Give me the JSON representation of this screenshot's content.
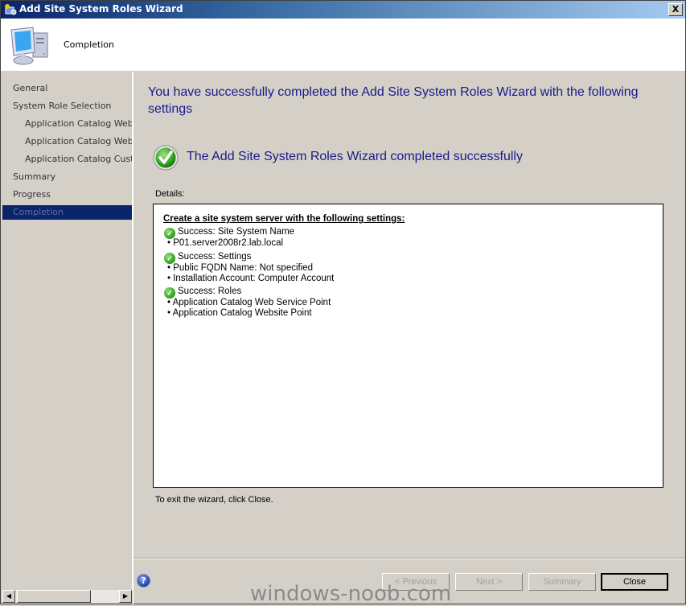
{
  "window": {
    "title": "Add Site System Roles Wizard",
    "close_label": "X"
  },
  "header": {
    "title": "Completion",
    "icon": "computer-icon"
  },
  "nav": {
    "items": [
      {
        "label": "General",
        "level": "top",
        "active": false
      },
      {
        "label": "System Role Selection",
        "level": "top",
        "active": false
      },
      {
        "label": "Application Catalog Web Service Point",
        "level": "sub",
        "active": false
      },
      {
        "label": "Application Catalog Website Point",
        "level": "sub",
        "active": false
      },
      {
        "label": "Application Catalog Customizations",
        "level": "sub",
        "active": false
      },
      {
        "label": "Summary",
        "level": "top",
        "active": false
      },
      {
        "label": "Progress",
        "level": "top",
        "active": false
      },
      {
        "label": "Completion",
        "level": "top",
        "active": true
      }
    ]
  },
  "main": {
    "heading": "You have successfully completed the Add Site System Roles Wizard with the following settings",
    "success_message": "The Add Site System Roles Wizard completed successfully",
    "details_label": "Details:",
    "details": {
      "header": "Create a site system server with the following settings:",
      "sections": [
        {
          "status": "Success: Site System Name",
          "items": [
            "P01.server2008r2.lab.local"
          ]
        },
        {
          "status": "Success: Settings",
          "items": [
            "Public FQDN Name: Not specified",
            "Installation Account: Computer Account"
          ]
        },
        {
          "status": "Success: Roles",
          "items": [
            "Application Catalog Web Service Point",
            "Application Catalog Website Point"
          ]
        }
      ]
    },
    "exit_text": "To exit the wizard, click Close."
  },
  "footer": {
    "buttons": {
      "previous": "< Previous",
      "next": "Next >",
      "summary": "Summary",
      "close": "Close"
    }
  },
  "watermark": "windows-noob.com",
  "colors": {
    "heading": "#1a1a8a",
    "nav_active_bg": "#0a246a",
    "titlebar_start": "#0a246a",
    "titlebar_end": "#a6caf0"
  }
}
